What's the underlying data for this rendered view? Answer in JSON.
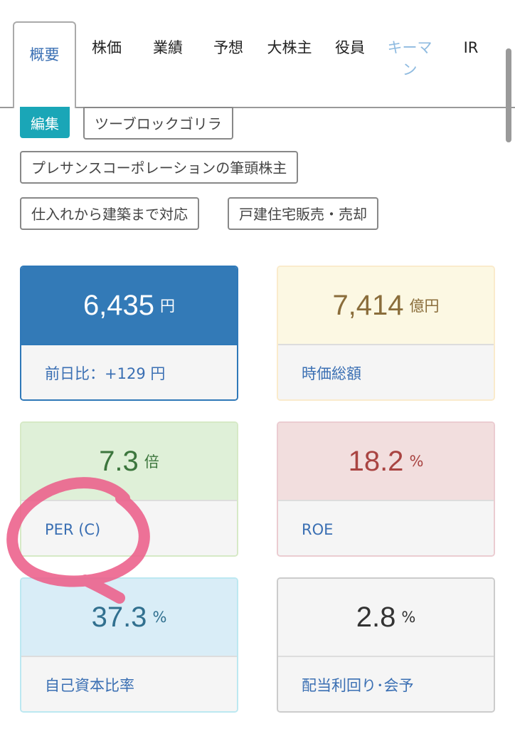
{
  "tabs": [
    {
      "label": "概要",
      "active": true
    },
    {
      "label": "株価"
    },
    {
      "label": "業績"
    },
    {
      "label": "予想"
    },
    {
      "label": "大株主"
    },
    {
      "label": "役員"
    },
    {
      "label": "キーマン",
      "muted": true
    },
    {
      "label": "IR"
    }
  ],
  "tags": {
    "edit": "編集",
    "items": [
      "ツーブロックゴリラ",
      "プレサンスコーポレーションの筆頭株主",
      "仕入れから建築まで対応",
      "戸建住宅販売・売却"
    ]
  },
  "cards": {
    "price": {
      "value": "6,435",
      "unit": "円",
      "label": "前日比：+129 円",
      "color": "#2f78b8"
    },
    "market_cap": {
      "value": "7,414",
      "unit": "億円",
      "label": "時価総額",
      "color": "#8a6d3b"
    },
    "per": {
      "value": "7.3",
      "unit": "倍",
      "label": "PER (C)",
      "color": "#3c763d"
    },
    "roe": {
      "value": "18.2",
      "unit": "%",
      "label": "ROE",
      "color": "#a94442"
    },
    "equity_ratio": {
      "value": "37.3",
      "unit": "%",
      "label": "自己資本比率",
      "color": "#31708f"
    },
    "dividend_yield": {
      "value": "2.8",
      "unit": "%",
      "label": "配当利回り･会予",
      "color": "#333333"
    }
  }
}
